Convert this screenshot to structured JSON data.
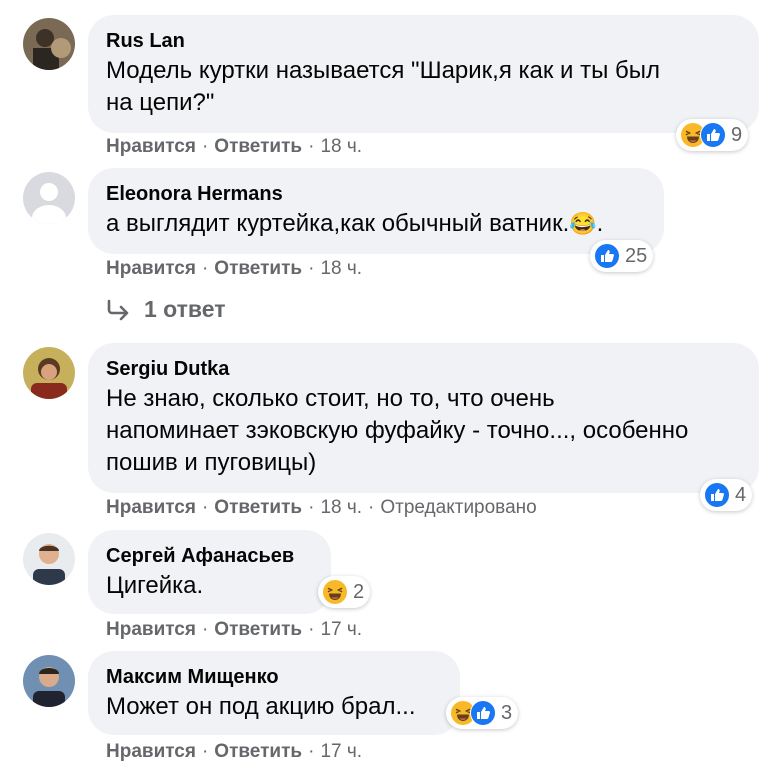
{
  "comments": [
    {
      "author": "Rus Lan",
      "text": "Модель куртки называется \"Шарик,я как и ты был\nна цепи?\"",
      "like": "Нравится",
      "reply": "Ответить",
      "time": "18 ч.",
      "reactions": 9,
      "reaction_icons": [
        "haha-icon",
        "like-icon"
      ]
    },
    {
      "author": "Eleonora Hermans",
      "text": "а выглядит куртейка,как обычный ватник.",
      "emoji": "😂",
      "emoji_tail": ".",
      "like": "Нравится",
      "reply": "Ответить",
      "time": "18 ч.",
      "reactions": 25,
      "reaction_icons": [
        "like-icon"
      ]
    },
    {
      "author": "Sergiu Dutka",
      "text": "Не знаю, сколько стоит, но то, что очень\nнапоминает зэковскую фуфайку - точно..., особенно\nпошив и пуговицы)",
      "like": "Нравится",
      "reply": "Ответить",
      "time": "18 ч.",
      "edited": "Отредактировано",
      "reactions": 4,
      "reaction_icons": [
        "like-icon"
      ]
    },
    {
      "author": "Сергей Афанасьев",
      "text": "Цигейка.",
      "like": "Нравится",
      "reply": "Ответить",
      "time": "17 ч.",
      "reactions": 2,
      "reaction_icons": [
        "haha-icon"
      ]
    },
    {
      "author": "Максим Мищенко",
      "text": "Может он под акцию брал...",
      "like": "Нравится",
      "reply": "Ответить",
      "time": "17 ч.",
      "reactions": 3,
      "reaction_icons": [
        "haha-icon",
        "like-icon"
      ]
    }
  ],
  "replies_link": "1 ответ",
  "colors": {
    "bubble": "#f0f2f5",
    "meta": "#65676b",
    "like_blue": "#1877f2",
    "haha_yellow": "#f7b928"
  }
}
